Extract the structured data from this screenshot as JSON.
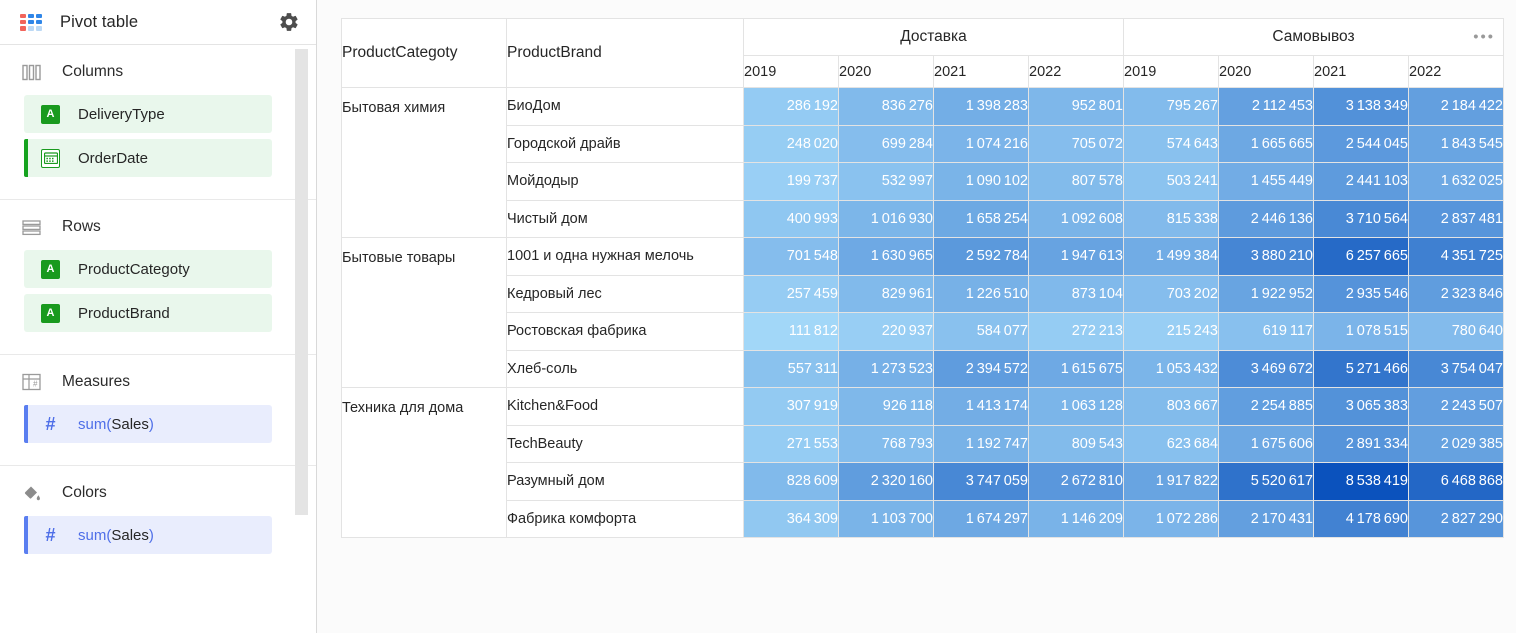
{
  "sidebar": {
    "title": "Pivot table",
    "logo_icon": "pivot-grid-icon",
    "settings_icon": "gear-icon",
    "sections": [
      {
        "label": "Columns",
        "icon": "columns-icon",
        "chips": [
          {
            "label": "DeliveryType",
            "icon": "attribute-text-icon",
            "glyph": "A",
            "kind": "dim",
            "accent": false
          },
          {
            "label": "OrderDate",
            "icon": "attribute-date-icon",
            "glyph": "☷",
            "kind": "dim",
            "accent": true
          }
        ]
      },
      {
        "label": "Rows",
        "icon": "rows-icon",
        "chips": [
          {
            "label": "ProductCategoty",
            "icon": "attribute-text-icon",
            "glyph": "A",
            "kind": "dim",
            "accent": false
          },
          {
            "label": "ProductBrand",
            "icon": "attribute-text-icon",
            "glyph": "A",
            "kind": "dim",
            "accent": false
          }
        ]
      },
      {
        "label": "Measures",
        "icon": "measures-table-icon",
        "chips": [
          {
            "label_fn": "sum",
            "label_arg": "(Sales)",
            "icon": "hash-measure-icon",
            "glyph": "#",
            "kind": "msr",
            "accent": true
          }
        ]
      },
      {
        "label": "Colors",
        "icon": "paint-bucket-icon",
        "chips": [
          {
            "label_fn": "sum",
            "label_arg": "(Sales)",
            "icon": "hash-measure-icon",
            "glyph": "#",
            "kind": "msr",
            "accent": true
          }
        ]
      }
    ],
    "scrollbar": "vertical-scrollbar"
  },
  "colors": {
    "accent_green": "#16a31f",
    "accent_blue": "#5a7ef0",
    "chip_dim_bg": "#e9f7ec",
    "chip_measure_bg": "#e9edfd",
    "heat_min": "#a2d7f8",
    "heat_max": "#0b52bd",
    "logo_red": "#f2655c",
    "logo_blue": "#2f86e8"
  },
  "pivot": {
    "row_header_labels": [
      "ProductCategoty",
      "ProductBrand"
    ],
    "column_groups": [
      {
        "label": "Доставка",
        "years": [
          "2019",
          "2020",
          "2021",
          "2022"
        ]
      },
      {
        "label": "Самовывоз",
        "years": [
          "2019",
          "2020",
          "2021",
          "2022"
        ]
      }
    ],
    "overflow_menu": "•••",
    "categories": [
      {
        "name": "Бытовая химия",
        "brands": [
          {
            "name": "БиоДом",
            "values": [
              286192,
              836276,
              1398283,
              952801,
              795267,
              2112453,
              3138349,
              2184422
            ]
          },
          {
            "name": "Городской драйв",
            "values": [
              248020,
              699284,
              1074216,
              705072,
              574643,
              1665665,
              2544045,
              1843545
            ]
          },
          {
            "name": "Мойдодыр",
            "values": [
              199737,
              532997,
              1090102,
              807578,
              503241,
              1455449,
              2441103,
              1632025
            ]
          },
          {
            "name": "Чистый дом",
            "values": [
              400993,
              1016930,
              1658254,
              1092608,
              815338,
              2446136,
              3710564,
              2837481
            ]
          }
        ]
      },
      {
        "name": "Бытовые товары",
        "brands": [
          {
            "name": "1001 и одна нужная мелочь",
            "values": [
              701548,
              1630965,
              2592784,
              1947613,
              1499384,
              3880210,
              6257665,
              4351725
            ]
          },
          {
            "name": "Кедровый лес",
            "values": [
              257459,
              829961,
              1226510,
              873104,
              703202,
              1922952,
              2935546,
              2323846
            ]
          },
          {
            "name": "Ростовская фабрика",
            "values": [
              111812,
              220937,
              584077,
              272213,
              215243,
              619117,
              1078515,
              780640
            ]
          },
          {
            "name": "Хлеб-соль",
            "values": [
              557311,
              1273523,
              2394572,
              1615675,
              1053432,
              3469672,
              5271466,
              3754047
            ]
          }
        ]
      },
      {
        "name": "Техника для дома",
        "brands": [
          {
            "name": "Kitchen&Food",
            "values": [
              307919,
              926118,
              1413174,
              1063128,
              803667,
              2254885,
              3065383,
              2243507
            ]
          },
          {
            "name": "TechBeauty",
            "values": [
              271553,
              768793,
              1192747,
              809543,
              623684,
              1675606,
              2891334,
              2029385
            ]
          },
          {
            "name": "Разумный дом",
            "values": [
              828609,
              2320160,
              3747059,
              2672810,
              1917822,
              5520617,
              8538419,
              6468868
            ]
          },
          {
            "name": "Фабрика комфорта",
            "values": [
              364309,
              1103700,
              1674297,
              1146209,
              1072286,
              2170431,
              4178690,
              2827290
            ]
          }
        ]
      }
    ]
  },
  "chart_data": {
    "type": "heatmap",
    "title": "sum(Sales) pivot by ProductCategoty / ProductBrand vs DeliveryType / OrderDate",
    "xlabel": "DeliveryType / OrderDate",
    "ylabel": "ProductCategoty / ProductBrand",
    "columns": [
      "Доставка 2019",
      "Доставка 2020",
      "Доставка 2021",
      "Доставка 2022",
      "Самовывоз 2019",
      "Самовывоз 2020",
      "Самовывоз 2021",
      "Самовывоз 2022"
    ],
    "rows": [
      "Бытовая химия / БиоДом",
      "Бытовая химия / Городской драйв",
      "Бытовая химия / Мойдодыр",
      "Бытовая химия / Чистый дом",
      "Бытовые товары / 1001 и одна нужная мелочь",
      "Бытовые товары / Кедровый лес",
      "Бытовые товары / Ростовская фабрика",
      "Бытовые товары / Хлеб-соль",
      "Техника для дома / Kitchen&Food",
      "Техника для дома / TechBeauty",
      "Техника для дома / Разумный дом",
      "Техника для дома / Фабрика комфорта"
    ],
    "values": [
      [
        286192,
        836276,
        1398283,
        952801,
        795267,
        2112453,
        3138349,
        2184422
      ],
      [
        248020,
        699284,
        1074216,
        705072,
        574643,
        1665665,
        2544045,
        1843545
      ],
      [
        199737,
        532997,
        1090102,
        807578,
        503241,
        1455449,
        2441103,
        1632025
      ],
      [
        400993,
        1016930,
        1658254,
        1092608,
        815338,
        2446136,
        3710564,
        2837481
      ],
      [
        701548,
        1630965,
        2592784,
        1947613,
        1499384,
        3880210,
        6257665,
        4351725
      ],
      [
        257459,
        829961,
        1226510,
        873104,
        703202,
        1922952,
        2935546,
        2323846
      ],
      [
        111812,
        220937,
        584077,
        272213,
        215243,
        619117,
        1078515,
        780640
      ],
      [
        557311,
        1273523,
        2394572,
        1615675,
        1053432,
        3469672,
        5271466,
        3754047
      ],
      [
        307919,
        926118,
        1413174,
        1063128,
        803667,
        2254885,
        3065383,
        2243507
      ],
      [
        271553,
        768793,
        1192747,
        809543,
        623684,
        1675606,
        2891334,
        2029385
      ],
      [
        828609,
        2320160,
        3747059,
        2672810,
        1917822,
        5520617,
        8538419,
        6468868
      ],
      [
        364309,
        1103700,
        1674297,
        1146209,
        1072286,
        2170431,
        4178690,
        2827290
      ]
    ],
    "zmin": 111812,
    "zmax": 8538419,
    "colorscale": [
      "#a2d7f8",
      "#0b52bd"
    ],
    "grid": true,
    "legend": "none"
  }
}
